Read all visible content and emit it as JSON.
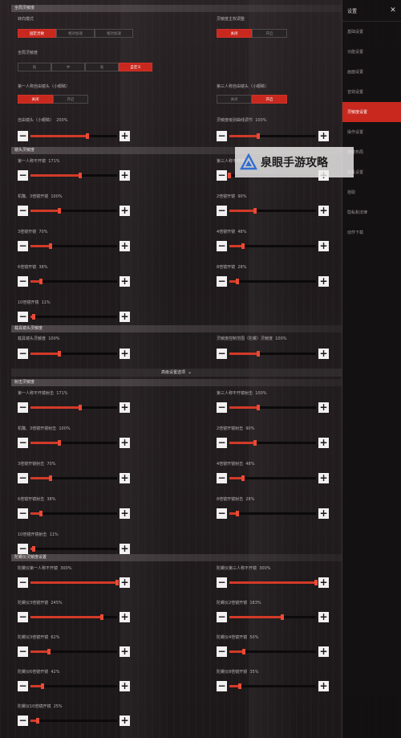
{
  "sidebar": {
    "title": "设置",
    "items": [
      {
        "label": "基础设置",
        "active": false
      },
      {
        "label": "功能设置",
        "active": false
      },
      {
        "label": "画面设置",
        "active": false
      },
      {
        "label": "音效设置",
        "active": false
      },
      {
        "label": "灵敏度设置",
        "active": true
      },
      {
        "label": "操作设置",
        "active": false
      },
      {
        "label": "按键布局",
        "active": false
      },
      {
        "label": "载具设置",
        "active": false
      },
      {
        "label": "拾取",
        "active": false
      },
      {
        "label": "隐私和法律",
        "active": false
      },
      {
        "label": "动作下载",
        "active": false
      }
    ]
  },
  "general": {
    "header": "全局灵敏度",
    "mode_label": "转向模式",
    "mode_options": [
      "固定灵敏",
      "相对加速",
      "相对加速"
    ],
    "mode_selected": 0,
    "gyro_label": "灵敏度主权调整",
    "gyro_options": [
      "关闭",
      "开启"
    ],
    "gyro_selected": 0,
    "global_label": "全局灵敏度",
    "global_options": [
      "低",
      "中",
      "高",
      "自定义"
    ],
    "global_selected": 3,
    "fp_lean_label": "第一人称自由镜头（小眼睛）",
    "fp_lean_options": [
      "关闭",
      "开启"
    ],
    "fp_lean_selected": 0,
    "tp_lean_label": "第三人称自由镜头（小眼睛）",
    "tp_lean_options": [
      "关闭",
      "开启"
    ],
    "tp_lean_selected": 1,
    "free_cam_label": "自由镜头（小眼睛）",
    "free_cam_value": "200%",
    "free_cam_fraction": 0.66,
    "free_cam2_label": "灵敏度级别曲线调节",
    "free_cam2_value": "100%",
    "free_cam2_fraction": 0.33
  },
  "camera": {
    "header": "镜头灵敏度",
    "items": [
      {
        "label": "第一人称不开镜",
        "value": "171%",
        "fraction": 0.57
      },
      {
        "label": "第三人称不开镜",
        "value": "",
        "fraction": 0.0
      },
      {
        "label": "机瞄、3倍镜开镜",
        "value": "100%",
        "fraction": 0.33
      },
      {
        "label": "2倍镜开镜",
        "value": "90%",
        "fraction": 0.3
      },
      {
        "label": "3倍镜开镜",
        "value": "70%",
        "fraction": 0.23
      },
      {
        "label": "4倍镜开镜",
        "value": "48%",
        "fraction": 0.16
      },
      {
        "label": "6倍镜开镜",
        "value": "38%",
        "fraction": 0.12
      },
      {
        "label": "8倍镜开镜",
        "value": "28%",
        "fraction": 0.09
      },
      {
        "label": "10倍镜开镜",
        "value": "11%",
        "fraction": 0.04
      }
    ]
  },
  "vehicle": {
    "header": "载具镜头灵敏度",
    "left_label": "载具镜头灵敏度",
    "left_value": "100%",
    "left_fraction": 0.33,
    "right_label": "灵敏度控制范围（陀螺）灵敏度",
    "right_value": "100%",
    "right_fraction": 0.33
  },
  "advanced": {
    "label": "高级设置选项",
    "chevron": "chevron-down-icon"
  },
  "fire": {
    "header": "射击灵敏度",
    "items": [
      {
        "label": "第一人称不开镜射击",
        "value": "171%",
        "fraction": 0.57
      },
      {
        "label": "第三人称不开镜射击",
        "value": "100%",
        "fraction": 0.33
      },
      {
        "label": "机瞄、3倍镜开镜射击",
        "value": "100%",
        "fraction": 0.33
      },
      {
        "label": "2倍镜开镜射击",
        "value": "90%",
        "fraction": 0.3
      },
      {
        "label": "3倍镜开镜射击",
        "value": "70%",
        "fraction": 0.23
      },
      {
        "label": "4倍镜开镜射击",
        "value": "48%",
        "fraction": 0.16
      },
      {
        "label": "6倍镜开镜射击",
        "value": "38%",
        "fraction": 0.12
      },
      {
        "label": "8倍镜开镜射击",
        "value": "28%",
        "fraction": 0.09
      },
      {
        "label": "10倍镜开镜射击",
        "value": "11%",
        "fraction": 0.04
      }
    ]
  },
  "gyro": {
    "header": "陀螺仪灵敏度设置",
    "items": [
      {
        "label": "陀螺仪第一人称不开镜",
        "value": "300%",
        "fraction": 1.0
      },
      {
        "label": "陀螺仪第三人称不开镜",
        "value": "300%",
        "fraction": 1.0
      },
      {
        "label": "陀螺仪3倍镜开镜",
        "value": "245%",
        "fraction": 0.82
      },
      {
        "label": "陀螺仪2倍镜开镜",
        "value": "183%",
        "fraction": 0.61
      },
      {
        "label": "陀螺仪3倍镜开镜",
        "value": "62%",
        "fraction": 0.21
      },
      {
        "label": "陀螺仪4倍镜开镜",
        "value": "50%",
        "fraction": 0.17
      },
      {
        "label": "陀螺仪6倍镜开镜",
        "value": "42%",
        "fraction": 0.14
      },
      {
        "label": "陀螺仪8倍镜开镜",
        "value": "35%",
        "fraction": 0.12
      },
      {
        "label": "陀螺仪10倍镜开镜",
        "value": "25%",
        "fraction": 0.08
      }
    ]
  },
  "controls": {
    "minus": "−",
    "plus": "+"
  },
  "watermark": {
    "text": "泉眼手游攻略"
  },
  "colors": {
    "accent": "#c8281e",
    "track": "#0c0a0b",
    "fill": "#d23a28"
  }
}
